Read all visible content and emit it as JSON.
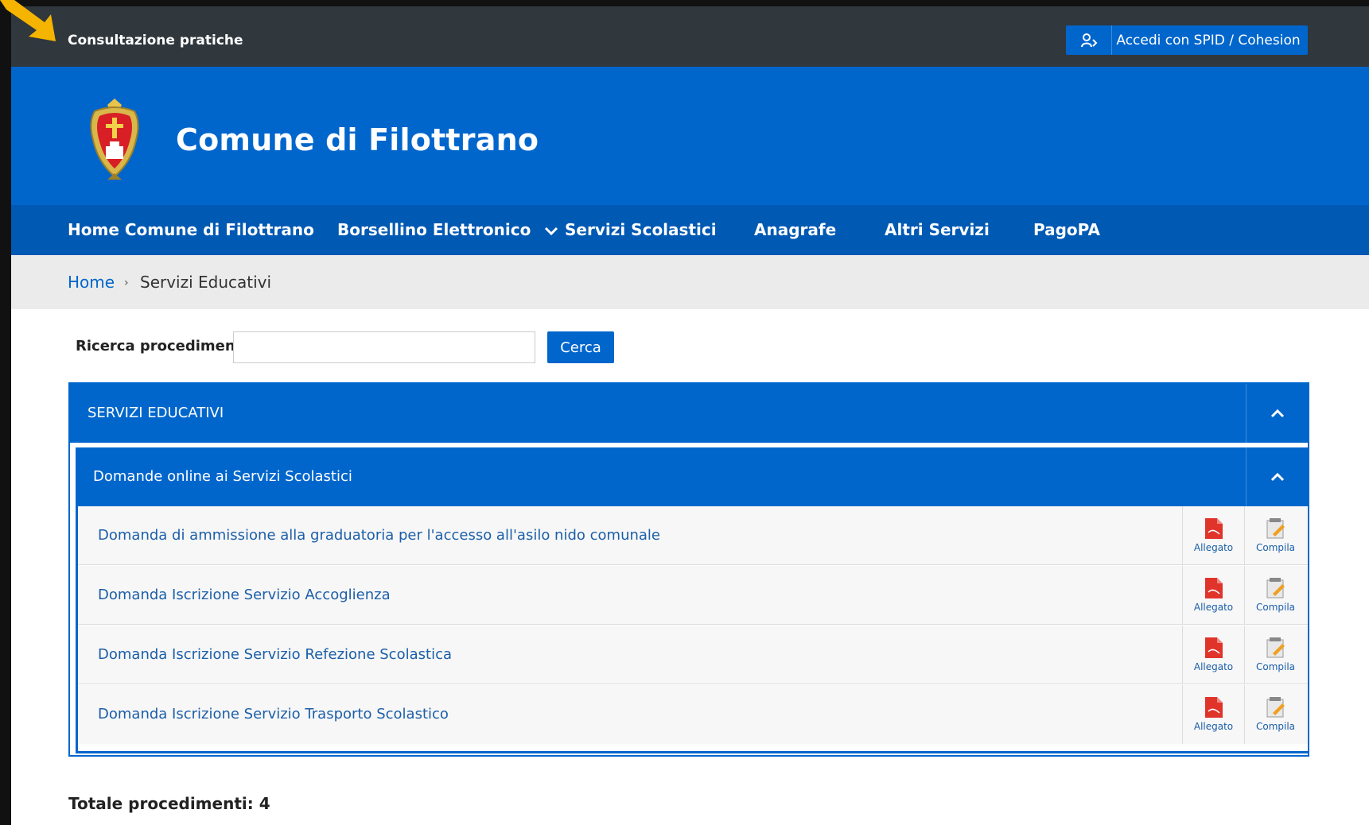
{
  "topbar": {
    "title": "Consultazione pratiche",
    "login_button": "Accedi con SPID / Cohesion"
  },
  "header": {
    "site_title": "Comune di Filottrano"
  },
  "nav": {
    "items": [
      {
        "label": "Home Comune di Filottrano"
      },
      {
        "label": "Borsellino Elettronico"
      },
      {
        "label": "Servizi Scolastici"
      },
      {
        "label": "Anagrafe"
      },
      {
        "label": "Altri Servizi"
      },
      {
        "label": "PagoPA"
      }
    ]
  },
  "breadcrumb": {
    "home": "Home",
    "separator": "›",
    "current": "Servizi Educativi"
  },
  "search": {
    "label": "Ricerca procedimenti",
    "value": "",
    "button": "Cerca"
  },
  "accordion": {
    "title": "SERVIZI EDUCATIVI",
    "group": {
      "title": "Domande online ai Servizi Scolastici",
      "rows": [
        {
          "label": "Domanda di ammissione alla graduatoria per l'accesso all'asilo nido comunale",
          "attachment": "Allegato",
          "fill": "Compila"
        },
        {
          "label": "Domanda Iscrizione Servizio Accoglienza",
          "attachment": "Allegato",
          "fill": "Compila"
        },
        {
          "label": "Domanda Iscrizione Servizio Refezione Scolastica",
          "attachment": "Allegato",
          "fill": "Compila"
        },
        {
          "label": "Domanda Iscrizione Servizio Trasporto Scolastico",
          "attachment": "Allegato",
          "fill": "Compila"
        }
      ]
    }
  },
  "footer": {
    "total": "Totale procedimenti: 4"
  },
  "colors": {
    "primary": "#0066cc",
    "nav": "#0059b3",
    "topbar": "#30373d",
    "breadcrumb_bg": "#ebebeb",
    "link": "#1b5ea8"
  }
}
